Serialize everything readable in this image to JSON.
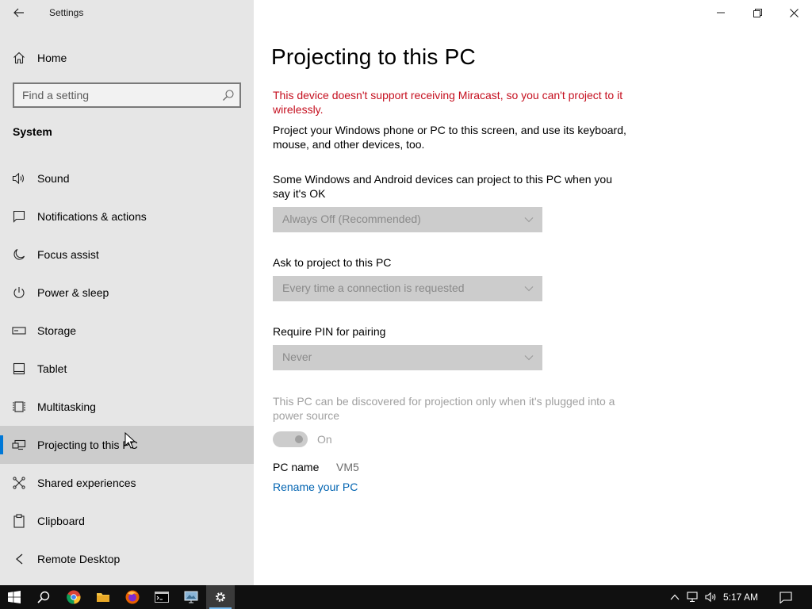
{
  "window": {
    "app_title": "Settings",
    "back_icon": "back-arrow-icon",
    "caption": {
      "minimize_icon": "minimize-icon",
      "maximize_icon": "maximize-icon",
      "close_icon": "close-icon"
    }
  },
  "sidebar": {
    "home": {
      "label": "Home",
      "icon": "home-icon"
    },
    "search": {
      "placeholder": "Find a setting",
      "icon": "search-icon"
    },
    "section_title": "System",
    "items": [
      {
        "label": "Sound",
        "icon": "speaker-icon",
        "selected": false
      },
      {
        "label": "Notifications & actions",
        "icon": "notification-icon",
        "selected": false
      },
      {
        "label": "Focus assist",
        "icon": "moon-icon",
        "selected": false
      },
      {
        "label": "Power & sleep",
        "icon": "power-icon",
        "selected": false
      },
      {
        "label": "Storage",
        "icon": "storage-icon",
        "selected": false
      },
      {
        "label": "Tablet",
        "icon": "tablet-icon",
        "selected": false
      },
      {
        "label": "Multitasking",
        "icon": "multitasking-icon",
        "selected": false
      },
      {
        "label": "Projecting to this PC",
        "icon": "projecting-icon",
        "selected": true
      },
      {
        "label": "Shared experiences",
        "icon": "shared-experiences-icon",
        "selected": false
      },
      {
        "label": "Clipboard",
        "icon": "clipboard-icon",
        "selected": false
      },
      {
        "label": "Remote Desktop",
        "icon": "remote-desktop-icon",
        "selected": false
      }
    ]
  },
  "main": {
    "title": "Projecting to this PC",
    "warning": "This device doesn't support receiving Miracast, so you can't project to it wirelessly.",
    "description": "Project your Windows phone or PC to this screen, and use its keyboard, mouse, and other devices, too.",
    "availability": {
      "label": "Some Windows and Android devices can project to this PC when you say it's OK",
      "value": "Always Off (Recommended)",
      "enabled": false
    },
    "ask": {
      "label": "Ask to project to this PC",
      "value": "Every time a connection is requested",
      "enabled": false
    },
    "pin": {
      "label": "Require PIN for pairing",
      "value": "Never",
      "enabled": false
    },
    "power_source": {
      "text": "This PC can be discovered for projection only when it's plugged into a power source",
      "toggle_state": "On",
      "enabled": false
    },
    "pc_name": {
      "label": "PC name",
      "value": "VM5"
    },
    "rename_link": "Rename your PC"
  },
  "taskbar": {
    "apps": [
      {
        "icon": "windows-start-icon",
        "active": false
      },
      {
        "icon": "search-icon",
        "active": false
      },
      {
        "icon": "chrome-icon",
        "active": false
      },
      {
        "icon": "file-explorer-icon",
        "active": false
      },
      {
        "icon": "firefox-icon",
        "active": false
      },
      {
        "icon": "command-prompt-icon",
        "active": false
      },
      {
        "icon": "remote-desktop-app-icon",
        "active": false
      },
      {
        "icon": "settings-gear-icon",
        "active": true
      }
    ],
    "tray": [
      "chevron-up-icon",
      "network-icon",
      "volume-icon"
    ],
    "clock": "5:17 AM",
    "notification_icon": "action-center-icon"
  },
  "colors": {
    "accent": "#0078d7",
    "warning": "#c50f1f",
    "link": "#0063b1",
    "sidebar_bg": "#e6e6e6",
    "taskbar_bg": "#101010"
  }
}
